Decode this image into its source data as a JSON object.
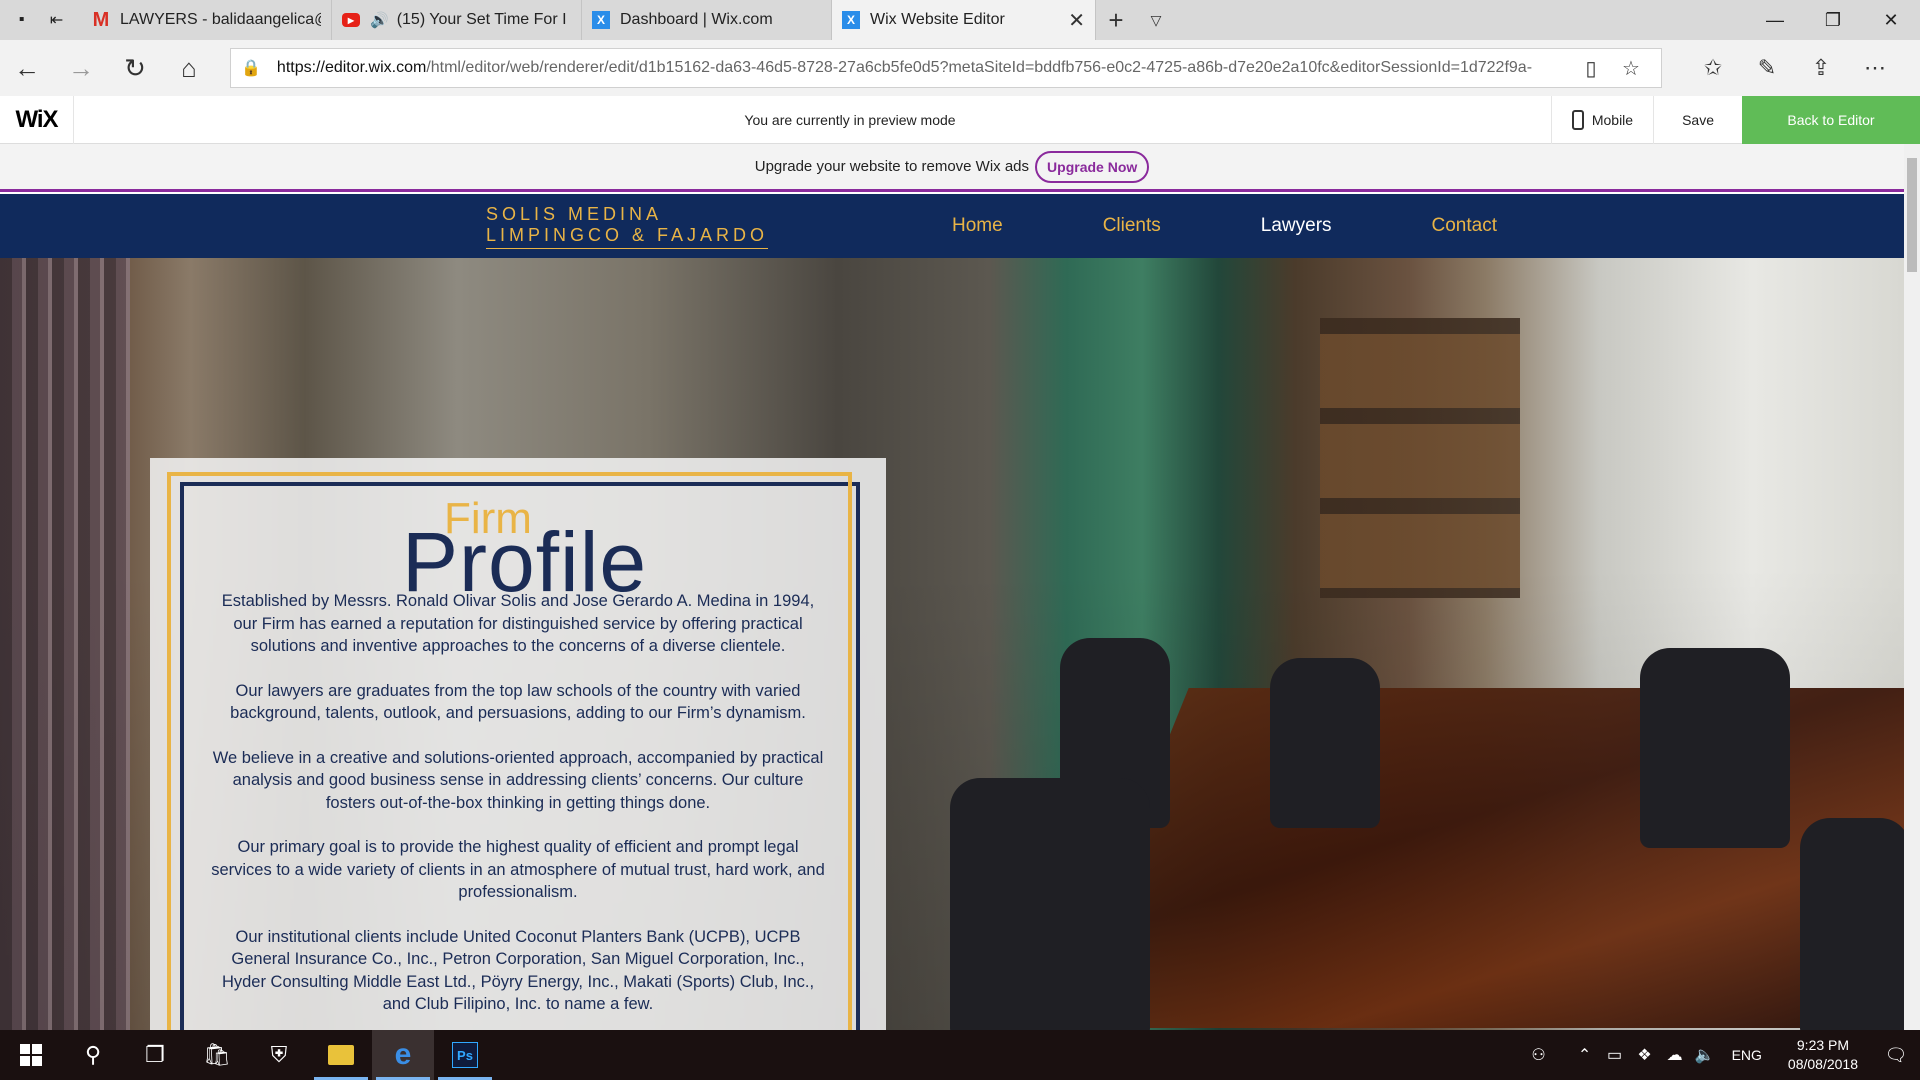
{
  "browser": {
    "tabs": [
      {
        "title": "LAWYERS - balidaangelica@",
        "icon": "gmail-icon"
      },
      {
        "title": "(15) Your Set Time For I",
        "icon": "youtube-icon",
        "audio": true
      },
      {
        "title": "Dashboard | Wix.com",
        "icon": "wix-icon"
      },
      {
        "title": "Wix Website Editor",
        "icon": "wix-icon",
        "active": true
      }
    ],
    "url_host": "https://editor.wix.com",
    "url_path": "/html/editor/web/renderer/edit/d1b15162-da63-46d5-8728-27a6cb5fe0d5?metaSiteId=bddfb756-e0c2-4725-a86b-d7e20e2a10fc&editorSessionId=1d722f9a-"
  },
  "wixbar": {
    "logo": "WiX",
    "preview_message": "You are currently in preview mode",
    "mobile_label": "Mobile",
    "save_label": "Save",
    "back_label": "Back to Editor",
    "accent": "#60bc57"
  },
  "upgrade": {
    "message": "Upgrade your website to remove Wix ads",
    "button": "Upgrade Now",
    "accent": "#8a2a9c"
  },
  "site": {
    "brand_line1": "SOLIS MEDINA",
    "brand_line2": "LIMPINGCO & FAJARDO",
    "nav": [
      "Home",
      "Clients",
      "Lawyers",
      "Contact"
    ],
    "nav_current": "Lawyers",
    "colors": {
      "navy": "#102a5c",
      "gold": "#e9b446"
    },
    "heading_small": "Firm",
    "heading_large": "Profile",
    "paragraphs": [
      "Established by Messrs. Ronald Olivar Solis and Jose Gerardo A. Medina in 1994, our Firm has earned a reputation for distinguished service by offering practical solutions and inventive approaches to the concerns of a diverse clientele.",
      "Our lawyers are graduates from the top law schools of the country with varied background, talents, outlook, and persuasions, adding to our Firm’s dynamism.",
      "We believe in a creative and solutions-oriented approach, accompanied by practical analysis and good business sense in addressing clients’ concerns. Our culture fosters out-of-the-box thinking in getting things done.",
      "Our primary goal is to provide the highest quality of efficient and prompt legal services to a wide variety of clients in an atmosphere of mutual trust, hard work, and professionalism.",
      "Our institutional clients include United Coconut Planters Bank (UCPB), UCPB General Insurance Co., Inc., Petron Corporation, San Miguel Corporation, Inc., Hyder Consulting Middle East Ltd., Pöyry Energy, Inc., Makati (Sports) Club, Inc., and Club Filipino, Inc. to name a few."
    ]
  },
  "taskbar": {
    "language": "ENG",
    "time": "9:23 PM",
    "date": "08/08/2018"
  }
}
